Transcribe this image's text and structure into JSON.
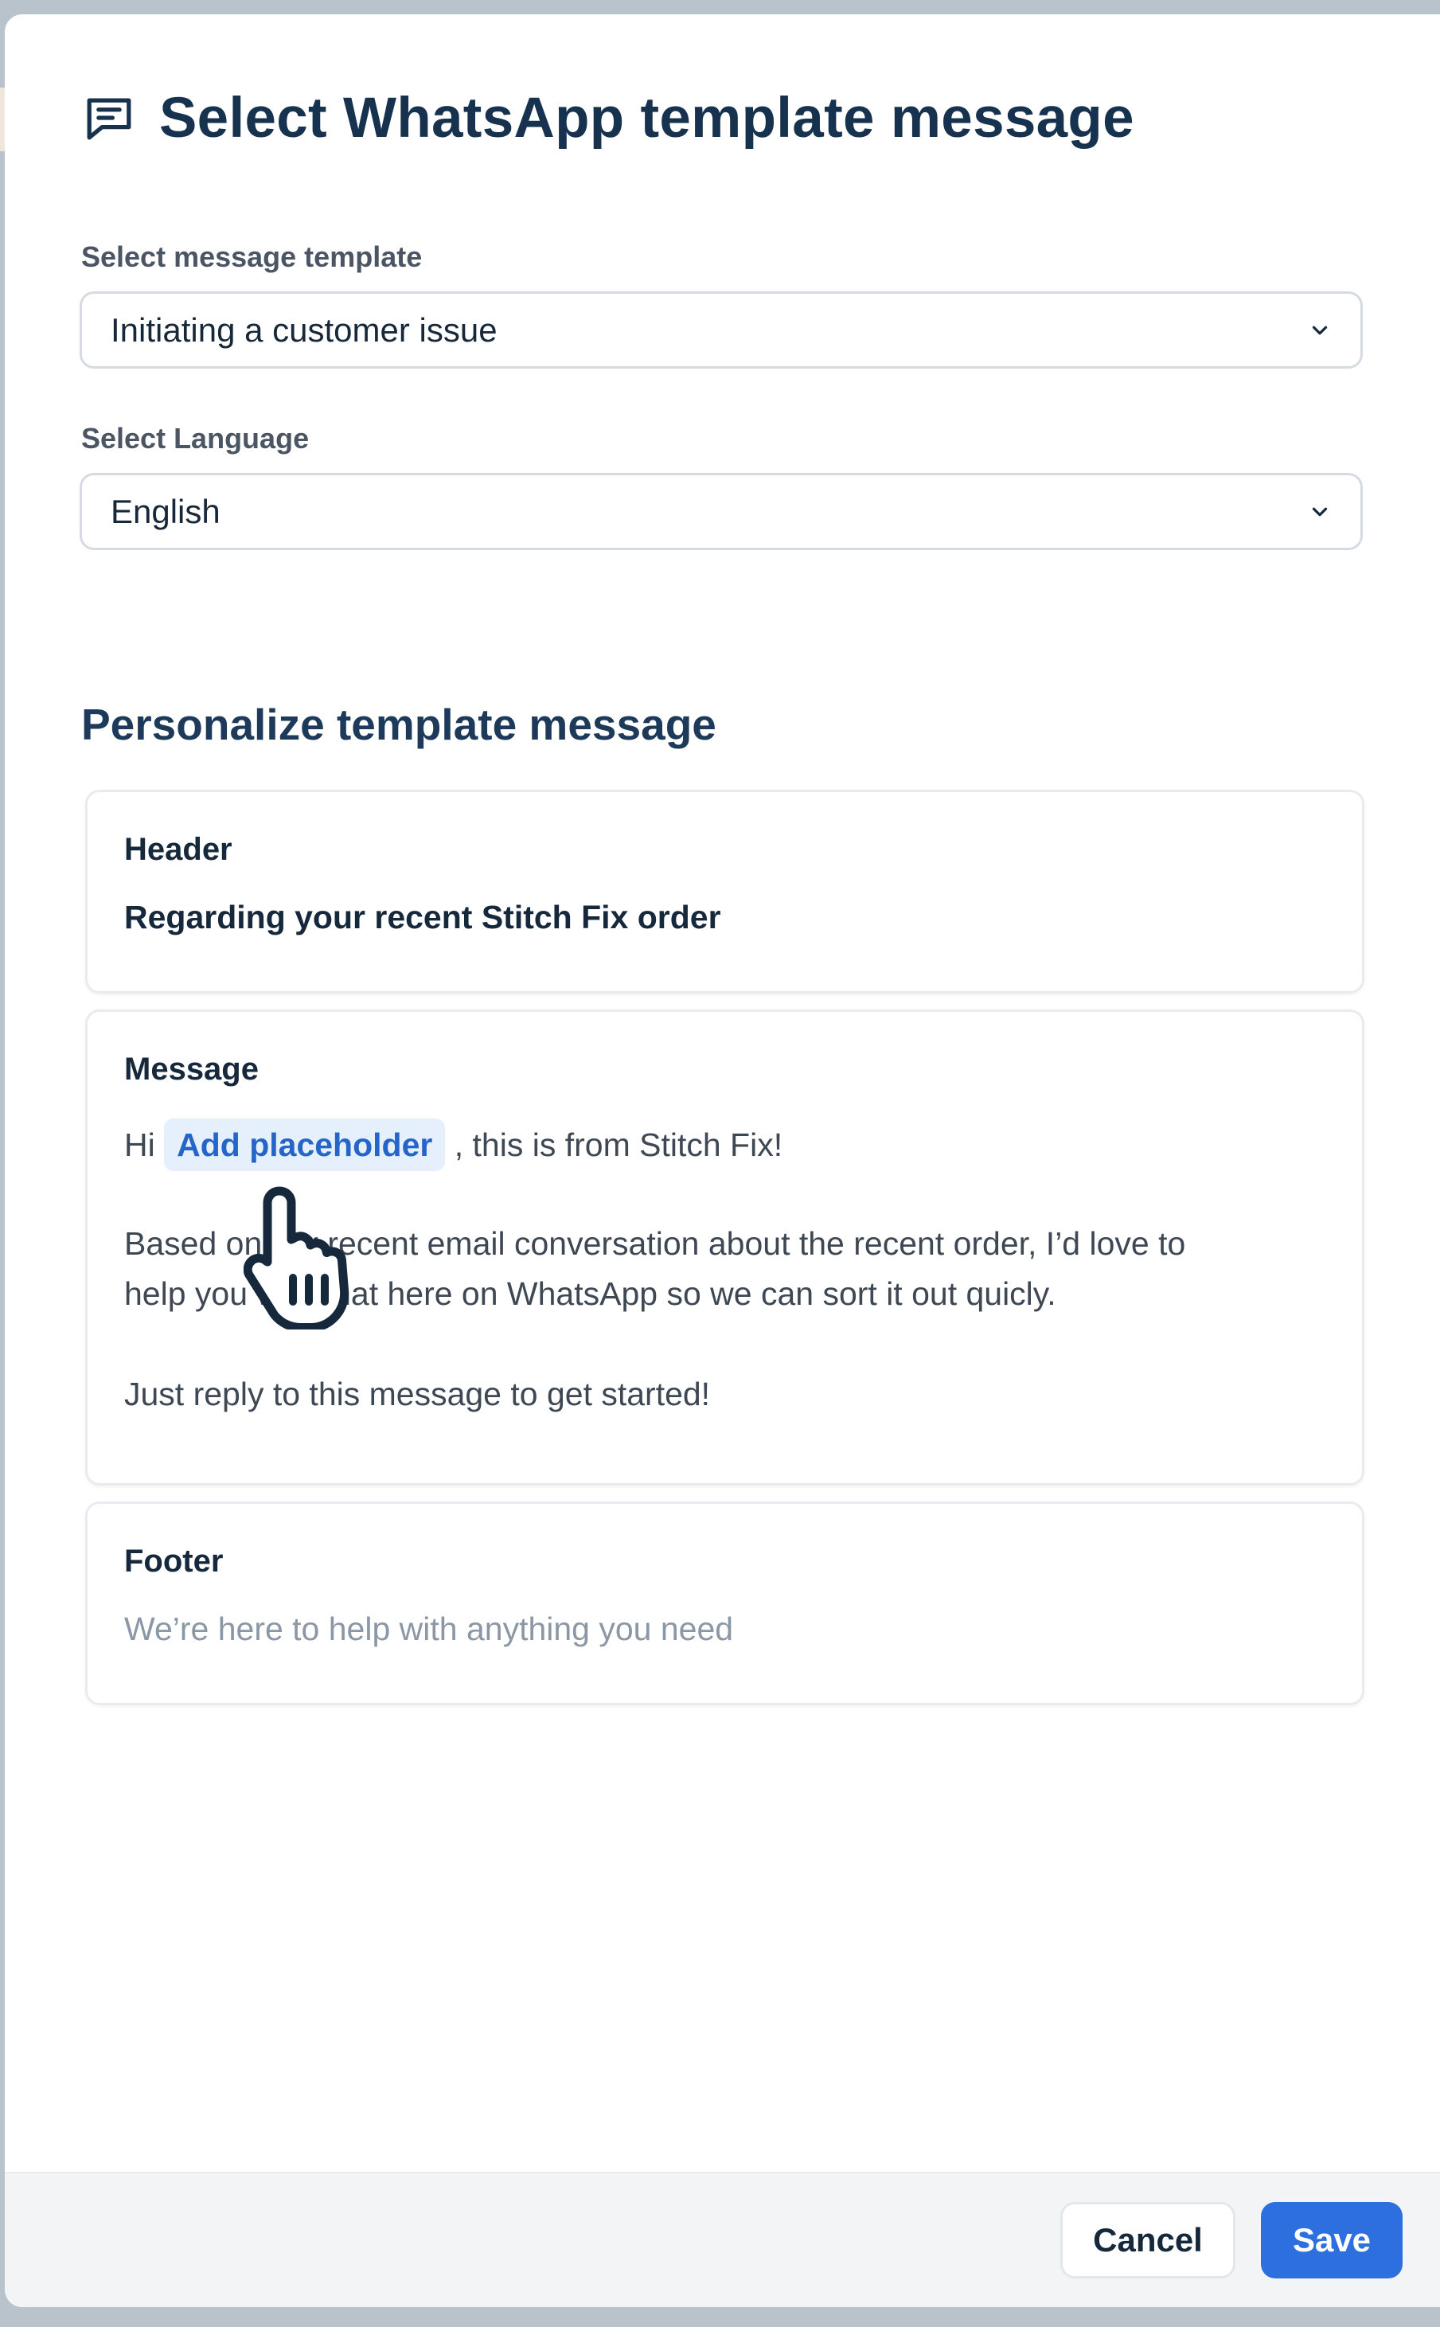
{
  "dialog": {
    "title": "Select WhatsApp template message",
    "title_icon": "message-square-icon"
  },
  "template_select": {
    "label": "Select message template",
    "value": "Initiating a customer issue"
  },
  "language_select": {
    "label": "Select Language",
    "value": "English"
  },
  "personalize": {
    "title": "Personalize template message",
    "header": {
      "label": "Header",
      "text": "Regarding your recent Stitch Fix order"
    },
    "message": {
      "label": "Message",
      "greeting_prefix": "Hi",
      "placeholder_button": "Add placeholder",
      "greeting_suffix": ", this is from Stitch Fix!",
      "paragraph_1_line_1": "Based on our recent email conversation about the recent order, I’d love to",
      "paragraph_1_line_2": "help you with that here on WhatsApp so we can sort it out quicly.",
      "paragraph_2": "Just reply to this message to get started!"
    },
    "footer": {
      "label": "Footer",
      "placeholder": "We’re here to help with anything you need"
    }
  },
  "actions": {
    "cancel_label": "Cancel",
    "save_label": "Save"
  },
  "colors": {
    "title": "#16324f",
    "accent": "#2e6fe0",
    "chip_bg": "#e6f0fc",
    "chip_text": "#2565c8",
    "footer_placeholder": "#8b97a4"
  },
  "icons": [
    "message-square-icon",
    "chevron-down-icon",
    "hand-pointer-cursor-icon"
  ]
}
